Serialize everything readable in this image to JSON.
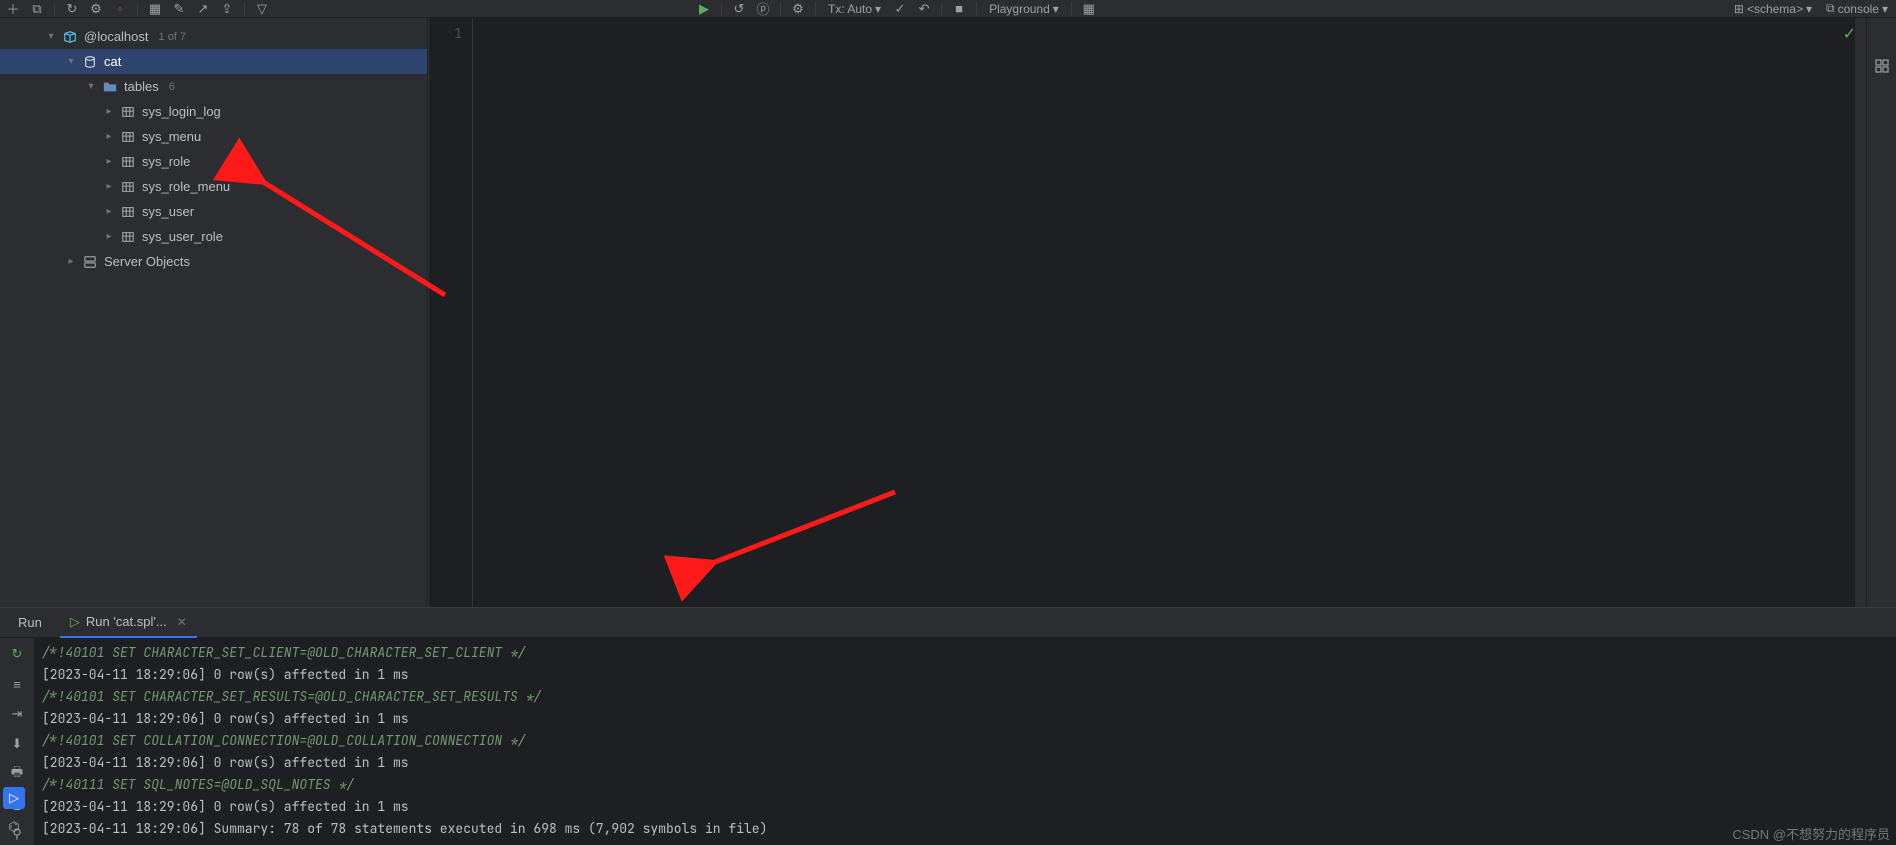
{
  "toolbar": {
    "tx_label": "Tx: Auto",
    "playground_label": "Playground",
    "schema_label": "<schema>",
    "console_label": "console"
  },
  "tree": {
    "connection": {
      "label": "@localhost",
      "badge": "1 of 7"
    },
    "schema": {
      "label": "cat"
    },
    "tables_folder": {
      "label": "tables",
      "count": "6"
    },
    "tables": [
      "sys_login_log",
      "sys_menu",
      "sys_role",
      "sys_role_menu",
      "sys_user",
      "sys_user_role"
    ],
    "server_objects": "Server Objects"
  },
  "editor": {
    "line_numbers": [
      "1"
    ]
  },
  "bottom": {
    "tab_run": "Run",
    "tab_script": "Run 'cat.spl'...",
    "lines": [
      {
        "type": "comment",
        "text": "/*!40101 SET CHARACTER_SET_CLIENT=@OLD_CHARACTER_SET_CLIENT */"
      },
      {
        "type": "log",
        "text": "[2023-04-11 18:29:06] 0 row(s) affected in 1 ms"
      },
      {
        "type": "comment",
        "text": "/*!40101 SET CHARACTER_SET_RESULTS=@OLD_CHARACTER_SET_RESULTS */"
      },
      {
        "type": "log",
        "text": "[2023-04-11 18:29:06] 0 row(s) affected in 1 ms"
      },
      {
        "type": "comment",
        "text": "/*!40101 SET COLLATION_CONNECTION=@OLD_COLLATION_CONNECTION */"
      },
      {
        "type": "log",
        "text": "[2023-04-11 18:29:06] 0 row(s) affected in 1 ms"
      },
      {
        "type": "comment",
        "text": "/*!40111 SET SQL_NOTES=@OLD_SQL_NOTES */"
      },
      {
        "type": "log",
        "text": "[2023-04-11 18:29:06] 0 row(s) affected in 1 ms"
      },
      {
        "type": "log",
        "text": "[2023-04-11 18:29:06] Summary: 78 of 78 statements executed in 698 ms (7,902 symbols in file)"
      }
    ]
  },
  "watermark": "CSDN @不想努力的程序员"
}
